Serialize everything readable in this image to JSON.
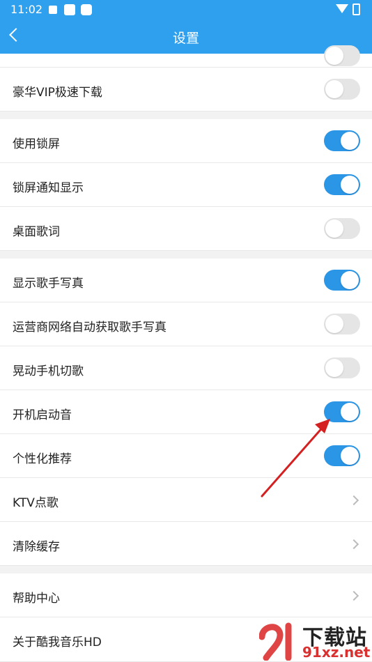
{
  "status_bar": {
    "time": "11:02"
  },
  "header": {
    "title": "设置"
  },
  "settings": {
    "vip_download": {
      "label": "豪华VIP极速下载",
      "enabled": false
    },
    "lock_screen": {
      "label": "使用锁屏",
      "enabled": true
    },
    "lock_notify": {
      "label": "锁屏通知显示",
      "enabled": true
    },
    "desktop_lyrics": {
      "label": "桌面歌词",
      "enabled": false
    },
    "singer_photo": {
      "label": "显示歌手写真",
      "enabled": true
    },
    "carrier_photo": {
      "label": "运营商网络自动获取歌手写真",
      "enabled": false
    },
    "shake_switch": {
      "label": "晃动手机切歌",
      "enabled": false
    },
    "boot_sound": {
      "label": "开机启动音",
      "enabled": true
    },
    "personalized": {
      "label": "个性化推荐",
      "enabled": true
    },
    "ktv": {
      "label": "KTV点歌"
    },
    "clear_cache": {
      "label": "清除缓存"
    },
    "help": {
      "label": "帮助中心"
    },
    "about": {
      "label": "关于酷我音乐HD"
    }
  },
  "watermark": {
    "brand": "下载站",
    "domain": "91xz.net"
  },
  "colors": {
    "accent": "#2ea0ee",
    "toggle_on": "#2b95e6",
    "annotation": "#d42020"
  }
}
